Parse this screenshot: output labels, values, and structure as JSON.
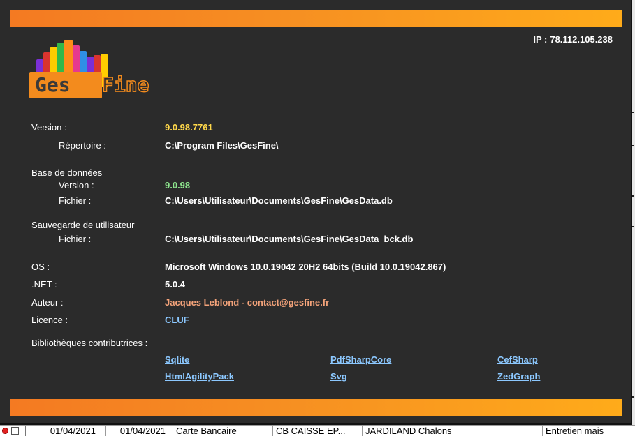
{
  "dialog": {
    "ip_label": "IP :",
    "ip_value": "78.112.105.238",
    "logo": {
      "text_left": "Ges",
      "text_right": "Fine",
      "bar_colors": [
        "#7b2fd6",
        "#d9342f",
        "#ffcc00",
        "#33b84a",
        "#ff8c1a",
        "#e6398f",
        "#2f8fe6"
      ]
    },
    "version": {
      "label": "Version :",
      "value": "9.0.98.7761"
    },
    "repertoire": {
      "label": "Répertoire :",
      "value": "C:\\Program Files\\GesFine\\"
    },
    "database": {
      "heading": "Base de données",
      "version_label": "Version :",
      "version_value": "9.0.98",
      "file_label": "Fichier :",
      "file_value": "C:\\Users\\Utilisateur\\Documents\\GesFine\\GesData.db"
    },
    "backup": {
      "heading": "Sauvegarde de utilisateur",
      "file_label": "Fichier :",
      "file_value": "C:\\Users\\Utilisateur\\Documents\\GesFine\\GesData_bck.db"
    },
    "os": {
      "label": "OS :",
      "value": "Microsoft Windows 10.0.19042 20H2  64bits  (Build 10.0.19042.867)"
    },
    "dotnet": {
      "label": ".NET :",
      "value": "5.0.4"
    },
    "author": {
      "label": "Auteur :",
      "value": "Jacques Leblond - contact@gesfine.fr"
    },
    "license": {
      "label": "Licence :",
      "value": "CLUF"
    },
    "libraries": {
      "heading": "Bibliothèques contributrices :",
      "items": [
        "Sqlite",
        "PdfSharpCore",
        "CefSharp",
        "HtmlAgilityPack",
        "Svg",
        "ZedGraph"
      ]
    },
    "colors": {
      "background": "#2b2b2b",
      "band_start": "#f47a22",
      "band_end": "#ffab1a",
      "version_value": "#ffd84a",
      "db_version_value": "#8ee68e",
      "author_value": "#f4a37a",
      "link": "#8cc8ff"
    }
  },
  "background_row": {
    "date1": "01/04/2021",
    "date2": "01/04/2021",
    "payment": "Carte Bancaire",
    "account": "CB CAISSE EP...",
    "payee": "JARDILAND Chalons",
    "category": "Entretien mais"
  }
}
